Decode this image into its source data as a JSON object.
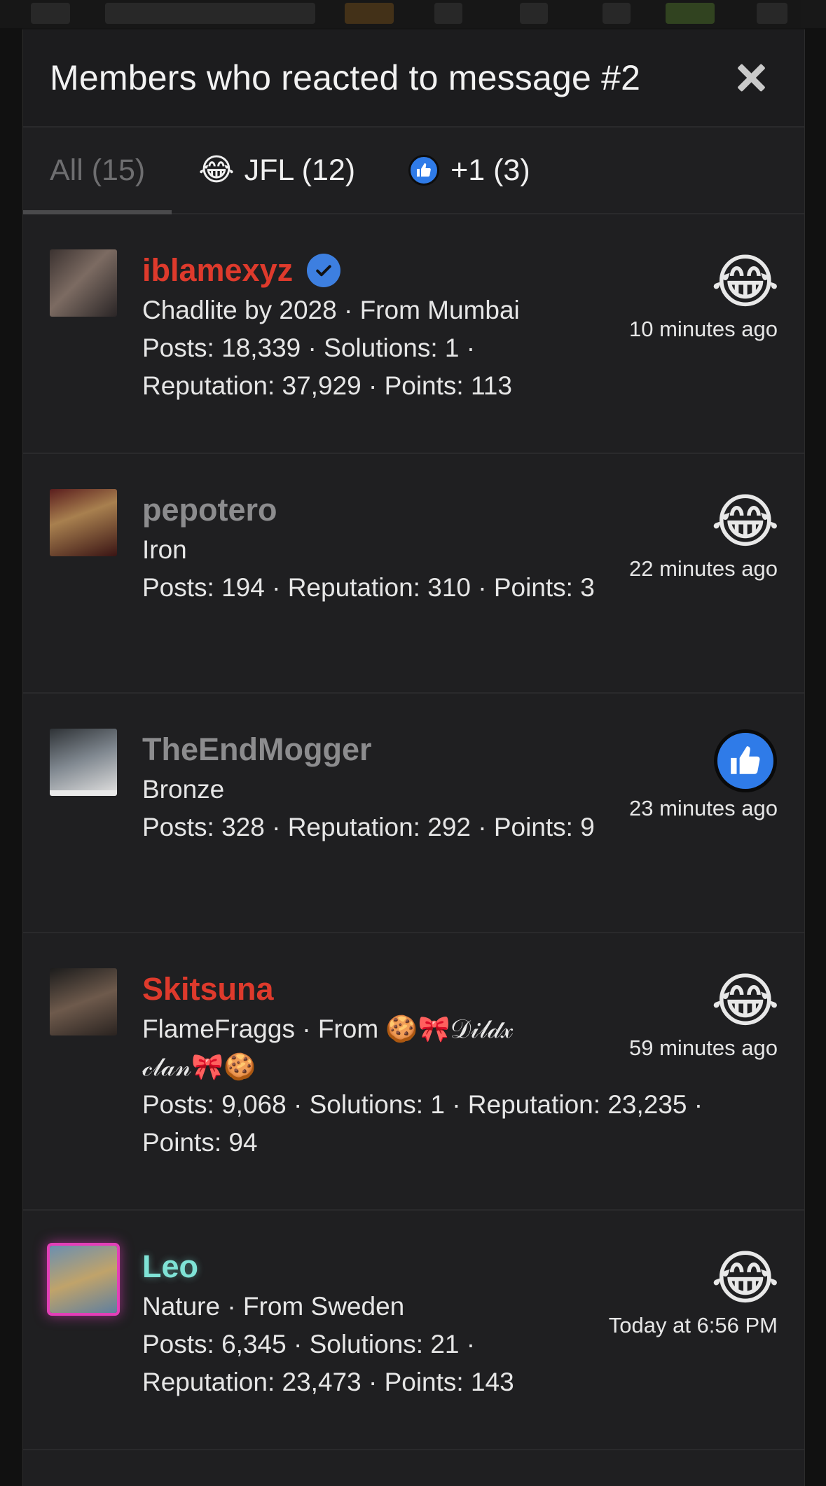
{
  "dialog": {
    "title": "Members who reacted to message #2"
  },
  "tabs": [
    {
      "label": "All (15)",
      "active": true
    },
    {
      "label": "JFL (12)",
      "emoji": "😂",
      "icon": "laughing-crying-emoji"
    },
    {
      "label": "+1 (3)",
      "icon": "thumbs-up-icon"
    }
  ],
  "members": [
    {
      "username": "iblamexyz",
      "verified": true,
      "meta": "Chadlite by 2028 · From Mumbai",
      "stats": "Posts: 18,339 · Solutions: 1 · Reputation: 37,929 · Points: 113",
      "reaction": "laughing-crying-emoji",
      "time": "10 minutes ago"
    },
    {
      "username": "pepotero",
      "meta": "Iron",
      "stats": "Posts: 194 · Reputation: 310 · Points: 3",
      "reaction": "laughing-crying-emoji",
      "time": "22 minutes ago"
    },
    {
      "username": "TheEndMogger",
      "meta": "Bronze",
      "stats": "Posts: 328 · Reputation: 292 · Points: 9",
      "reaction": "thumbs-up-icon",
      "time": "23 minutes ago"
    },
    {
      "username": "Skitsuna",
      "meta": "FlameFraggs · From 🍪🎀𝒟𝒾𝓁𝒹𝓍 𝒸𝓁𝒶𝓃🎀🍪",
      "stats": "Posts: 9,068 · Solutions: 1 · Reputation: 23,235 · Points: 94",
      "reaction": "laughing-crying-emoji",
      "time": "59 minutes ago"
    },
    {
      "username": "Leo",
      "meta": "Nature · From Sweden",
      "stats": "Posts: 6,345 · Solutions: 21 · Reputation: 23,473 · Points: 143",
      "reaction": "laughing-crying-emoji",
      "time": "Today at 6:56 PM"
    }
  ],
  "reaction_emoji": "😂",
  "colors": {
    "username_red": "#de3a2c",
    "username_gray": "#8c8c8e",
    "username_teal": "#7fe3d6",
    "verified_blue": "#3d7fe0",
    "like_blue": "#2f7be8"
  }
}
